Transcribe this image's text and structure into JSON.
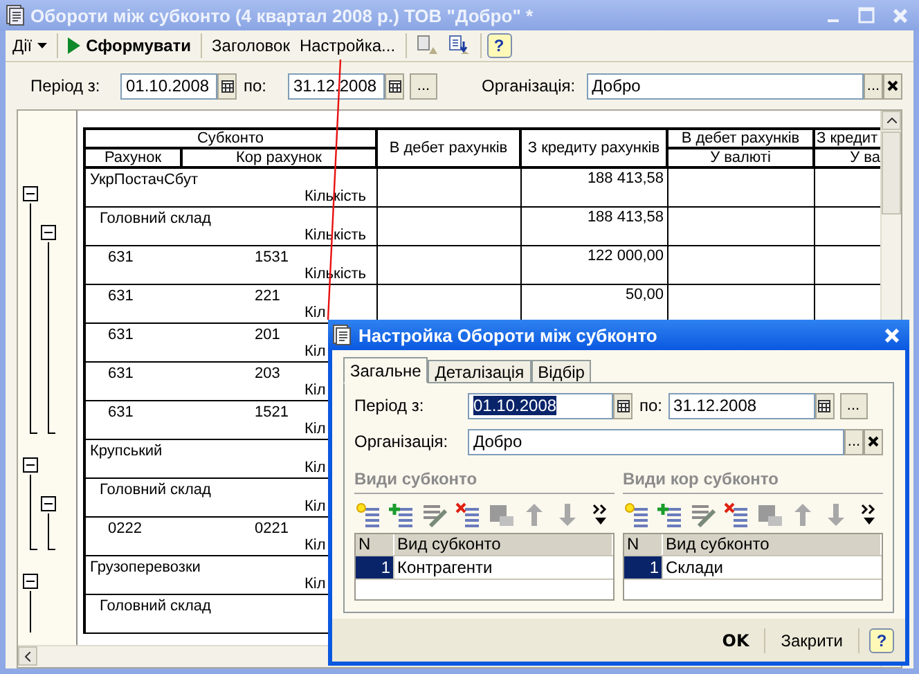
{
  "window": {
    "title": "Обороти між субконто (4 квартал 2008 р.) ТОВ \"Добро\" *"
  },
  "toolbar": [
    {
      "kind": "menu",
      "label": "Дії"
    },
    {
      "kind": "separator"
    },
    {
      "kind": "run",
      "label": "Сформувати"
    },
    {
      "kind": "separator"
    },
    {
      "kind": "text",
      "label": "Заголовок"
    },
    {
      "kind": "text",
      "label": "Настройка..."
    },
    {
      "kind": "separator"
    },
    {
      "kind": "copy"
    },
    {
      "kind": "export"
    },
    {
      "kind": "separator"
    },
    {
      "kind": "help",
      "label": "?"
    }
  ],
  "params": {
    "period_from_label": "Період з:",
    "period_from": "01.10.2008",
    "period_to_label": "по:",
    "period_to": "31.12.2008",
    "more_button": "...",
    "organization_label": "Організація:",
    "organization": "Добро",
    "select_button": "..."
  },
  "report": {
    "header": {
      "subconto": "Субконто",
      "account": "Рахунок",
      "cor_account": "Кор рахунок",
      "debit": "В дебет рахунків",
      "credit": "З кредиту рахунків",
      "debit_currency": "В дебет рахунків",
      "debit_currency_sub": "У валюті",
      "credit_currency": "З кредит",
      "credit_currency_sub": "У ва"
    },
    "rows": [
      {
        "name": "УкрПостачСбут",
        "qty_label": "Кількість",
        "credit": "188 413,58",
        "expanded": true,
        "children": [
          {
            "name": "Головний склад",
            "qty_label": "Кількість",
            "credit": "188 413,58",
            "expanded": true,
            "children": [
              {
                "account": "631",
                "cor_account": "1531",
                "qty_label": "Кількість",
                "credit": "122 000,00"
              },
              {
                "account": "631",
                "cor_account": "221",
                "qty_label": "Кіл",
                "credit": "50,00"
              },
              {
                "account": "631",
                "cor_account": "201",
                "qty_label": "Кіл"
              },
              {
                "account": "631",
                "cor_account": "203",
                "qty_label": "Кіл"
              },
              {
                "account": "631",
                "cor_account": "1521",
                "qty_label": "Кіл"
              }
            ]
          }
        ]
      },
      {
        "name": "Крупський",
        "qty_label": "Кіл",
        "expanded": true,
        "children": [
          {
            "name": "Головний склад",
            "qty_label": "Кіл",
            "expanded": true,
            "children": [
              {
                "account": "0222",
                "cor_account": "0221",
                "qty_label": "Кіл"
              }
            ]
          }
        ]
      },
      {
        "name": "Грузоперевозки",
        "qty_label": "Кіл",
        "expanded": true,
        "children": [
          {
            "name": "Головний склад"
          }
        ]
      }
    ]
  },
  "dialog": {
    "title": "Настройка Обороти між субконто",
    "tabs": [
      {
        "label": "Загальне",
        "selected": true
      },
      {
        "label": "Деталізація",
        "selected": false
      },
      {
        "label": "Відбір",
        "selected": false
      }
    ],
    "period_from_label": "Період з:",
    "period_from": {
      "value": "01.10.2008",
      "text_selected": true
    },
    "period_to_label": "по:",
    "period_to": "31.12.2008",
    "more_button": "...",
    "organization_label": "Організація:",
    "organization": "Добро",
    "select_button": "...",
    "panels": [
      {
        "title": "Види субконто",
        "tools": [
          {
            "kind": "new",
            "disabled": false
          },
          {
            "kind": "add",
            "disabled": false
          },
          {
            "kind": "edit",
            "disabled": true
          },
          {
            "kind": "delete",
            "disabled": false
          },
          {
            "kind": "save",
            "disabled": true
          },
          {
            "kind": "up",
            "disabled": true
          },
          {
            "kind": "down",
            "disabled": true
          },
          {
            "kind": "more",
            "disabled": false
          }
        ],
        "columns": [
          "N",
          "Вид субконто"
        ],
        "rows": [
          {
            "n": "1",
            "value": "Контрагенти",
            "selected": true
          }
        ]
      },
      {
        "title": "Види кор субконто",
        "tools": [
          {
            "kind": "new",
            "disabled": false
          },
          {
            "kind": "add",
            "disabled": false
          },
          {
            "kind": "edit",
            "disabled": true
          },
          {
            "kind": "delete",
            "disabled": false
          },
          {
            "kind": "save",
            "disabled": true
          },
          {
            "kind": "up",
            "disabled": true
          },
          {
            "kind": "down",
            "disabled": true
          },
          {
            "kind": "more",
            "disabled": false
          }
        ],
        "columns": [
          "N",
          "Вид субконто"
        ],
        "rows": [
          {
            "n": "1",
            "value": "Склади",
            "selected": true
          }
        ]
      }
    ],
    "buttons": [
      {
        "kind": "ok",
        "label": "OK"
      },
      {
        "kind": "close",
        "label": "Закрити"
      },
      {
        "kind": "help",
        "label": "?"
      }
    ]
  }
}
